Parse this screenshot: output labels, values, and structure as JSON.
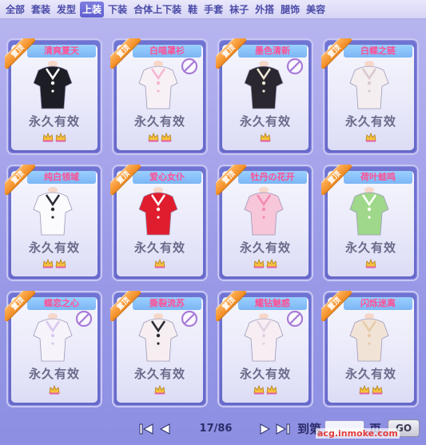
{
  "tabs": [
    {
      "label": "全部",
      "active": false
    },
    {
      "label": "套装",
      "active": false
    },
    {
      "label": "发型",
      "active": false
    },
    {
      "label": "上装",
      "active": true
    },
    {
      "label": "下装",
      "active": false
    },
    {
      "label": "合体上下装",
      "active": false
    },
    {
      "label": "鞋",
      "active": false
    },
    {
      "label": "手套",
      "active": false
    },
    {
      "label": "袜子",
      "active": false
    },
    {
      "label": "外搭",
      "active": false
    },
    {
      "label": "腿饰",
      "active": false
    },
    {
      "label": "美容",
      "active": false
    }
  ],
  "ribbon_label": "置顶",
  "items": [
    {
      "name": "清爽夏天",
      "duration": "永久有效",
      "crowns": 2,
      "forbidden": false,
      "top_color": "#1d1d26",
      "accent": "#ffffff"
    },
    {
      "name": "白喵罩衫",
      "duration": "永久有效",
      "crowns": 2,
      "forbidden": true,
      "top_color": "#f7f1f6",
      "accent": "#f6b6d2"
    },
    {
      "name": "墨色清新",
      "duration": "永久有效",
      "crowns": 1,
      "forbidden": true,
      "top_color": "#2a2730",
      "accent": "#f0e9d6"
    },
    {
      "name": "白蝶之链",
      "duration": "永久有效",
      "crowns": 1,
      "forbidden": false,
      "top_color": "#f5eef0",
      "accent": "#d9c9cf"
    },
    {
      "name": "纯白领域",
      "duration": "永久有效",
      "crowns": 2,
      "forbidden": false,
      "top_color": "#fbfbfd",
      "accent": "#2a2a33"
    },
    {
      "name": "爱心女仆",
      "duration": "永久有效",
      "crowns": 1,
      "forbidden": false,
      "top_color": "#e01d2e",
      "accent": "#ffffff"
    },
    {
      "name": "牡丹の花开",
      "duration": "永久有效",
      "crowns": 2,
      "forbidden": false,
      "top_color": "#f7c6d8",
      "accent": "#f48ab2"
    },
    {
      "name": "荷叶蛙鸣",
      "duration": "永久有效",
      "crowns": 1,
      "forbidden": false,
      "top_color": "#9fd88a",
      "accent": "#ffffff"
    },
    {
      "name": "蝶恋之心",
      "duration": "永久有效",
      "crowns": 1,
      "forbidden": true,
      "top_color": "#f7f3fb",
      "accent": "#d8c7ef"
    },
    {
      "name": "撕裂流苏",
      "duration": "永久有效",
      "crowns": 1,
      "forbidden": true,
      "top_color": "#f6eef0",
      "accent": "#2a2a33"
    },
    {
      "name": "耀钻魅惑",
      "duration": "永久有效",
      "crowns": 2,
      "forbidden": true,
      "top_color": "#f6eef3",
      "accent": "#e3d1e2"
    },
    {
      "name": "闪烁迷离",
      "duration": "永久有效",
      "crowns": 2,
      "forbidden": false,
      "top_color": "#f2e3d7",
      "accent": "#e7cba8"
    }
  ],
  "pager": {
    "page_indicator": "17/86",
    "goto_label": "到第",
    "page_input_value": "",
    "page_suffix": "页",
    "go_label": "GO"
  },
  "watermark": "acg.inmoke.com",
  "colors": {
    "active_tab": "#6666d6",
    "name_text": "#ff4f93",
    "ribbon": "#f59a36"
  }
}
